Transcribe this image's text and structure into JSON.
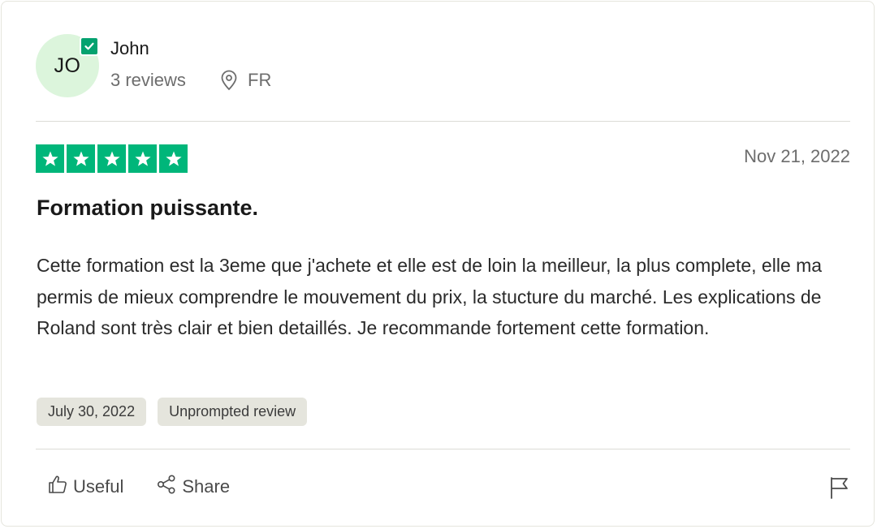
{
  "reviewer": {
    "initials": "JO",
    "name": "John",
    "reviews": "3 reviews",
    "country": "FR",
    "verified_icon": "check-badge-icon",
    "location_icon": "map-pin-icon"
  },
  "review": {
    "rating": 5,
    "rating_max": 5,
    "date": "Nov 21, 2022",
    "title": "Formation puissante.",
    "body": "Cette formation est la 3eme que j'achete et elle est de loin la meilleur, la plus complete, elle ma permis de mieux comprendre le mouvement du prix, la stucture du marché. Les explications de Roland sont très clair et bien detaillés. Je recommande fortement cette formation.",
    "tags": [
      "July 30, 2022",
      "Unprompted review"
    ]
  },
  "actions": {
    "useful": "Useful",
    "share": "Share"
  },
  "colors": {
    "star": "#00b67a",
    "avatar_bg": "#dcf5dc",
    "verified": "#04a26f",
    "tag_bg": "#e5e5dd"
  }
}
